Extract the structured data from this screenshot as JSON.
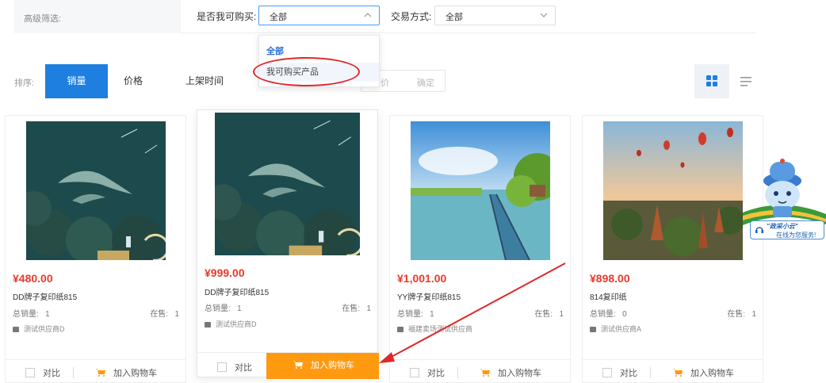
{
  "filter": {
    "title": "高级筛选:",
    "can_buy_label": "是否我可购买:",
    "can_buy_value": "全部",
    "trade_label": "交易方式:",
    "trade_value": "全部",
    "dropdown_options": [
      "全部",
      "我可购买产品"
    ]
  },
  "sort": {
    "label": "排序:",
    "options": [
      "销量",
      "价格",
      "上架时间"
    ],
    "active": "销量",
    "price_from": "价",
    "confirm": "确定"
  },
  "products": [
    {
      "price": "¥480.00",
      "name": "DD牌子复印纸815",
      "sales_label": "总销量:",
      "sales": "1",
      "onsale_label": "在售:",
      "onsale": "1",
      "supplier": "测试供应商D",
      "compare": "对比",
      "cart": "加入购物车"
    },
    {
      "price": "¥999.00",
      "name": "DD牌子复印纸815",
      "sales_label": "总销量:",
      "sales": "1",
      "onsale_label": "在售:",
      "onsale": "1",
      "supplier": "测试供应商D",
      "compare": "对比",
      "cart": "加入购物车"
    },
    {
      "price": "¥1,001.00",
      "name": "YY牌子复印纸815",
      "sales_label": "总销量:",
      "sales": "1",
      "onsale_label": "在售:",
      "onsale": "1",
      "supplier": "福建卖场测试供应商",
      "compare": "对比",
      "cart": "加入购物车"
    },
    {
      "price": "¥898.00",
      "name": "814复印纸",
      "sales_label": "总销量:",
      "sales": "0",
      "onsale_label": "在售:",
      "onsale": "1",
      "supplier": "测试供应商A",
      "compare": "对比",
      "cart": "加入购物车"
    }
  ],
  "mascot": {
    "line1": "\"政采小云\"",
    "line2": "在线为您服务!"
  },
  "colors": {
    "primary": "#1e7fe0",
    "price": "#e83b2b",
    "cart_button": "#ff9a10",
    "annotation": "#e0282a"
  }
}
